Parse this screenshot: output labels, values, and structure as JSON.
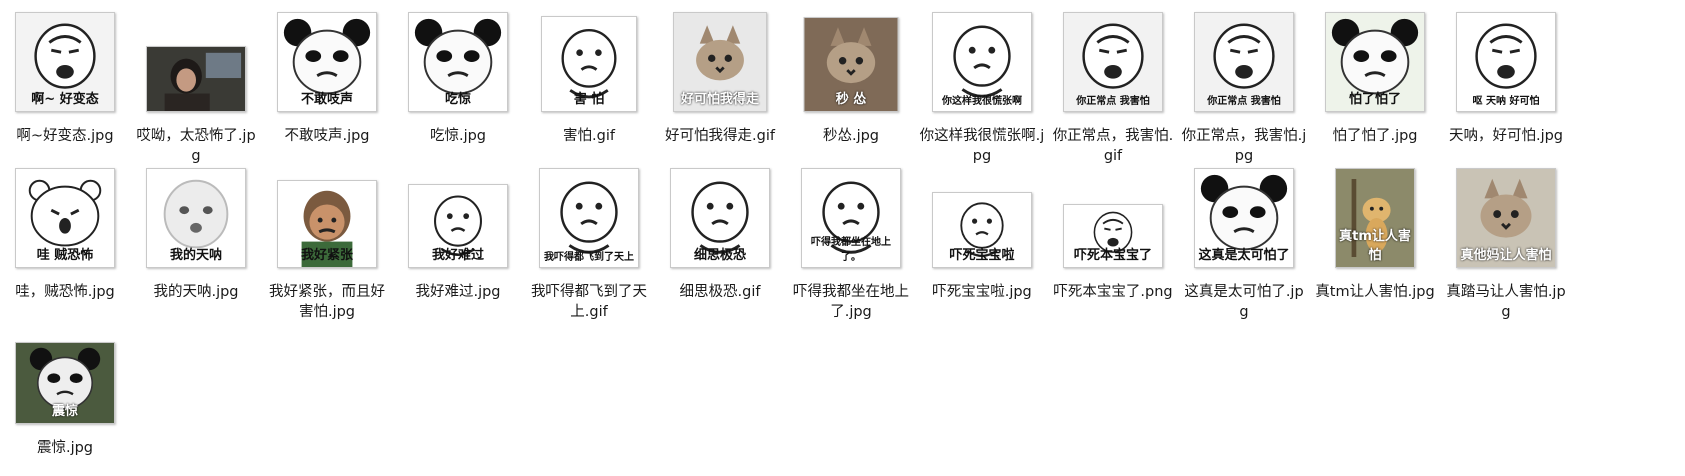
{
  "files": [
    {
      "name": "啊~好变态.jpg",
      "thumb_text": "啊~ 好变态",
      "kind": "man",
      "bg": "#f3f3f3"
    },
    {
      "name": "哎呦，太恐怖了.jpg",
      "thumb_text": "",
      "kind": "photo",
      "bg": "#3a3a35"
    },
    {
      "name": "不敢吱声.jpg",
      "thumb_text": "不敢吱声",
      "kind": "panda",
      "bg": "#ffffff"
    },
    {
      "name": "吃惊.jpg",
      "thumb_text": "吃惊",
      "kind": "panda",
      "bg": "#ffffff"
    },
    {
      "name": "害怕.gif",
      "thumb_text": "害 怕",
      "kind": "blob",
      "bg": "#ffffff"
    },
    {
      "name": "好可怕我得走.gif",
      "thumb_text": "好可怕我得走",
      "kind": "cat",
      "bg": "#e8e8e8"
    },
    {
      "name": "秒怂.jpg",
      "thumb_text": "秒 怂",
      "kind": "cat",
      "bg": "#7f6a57"
    },
    {
      "name": "你这样我很慌张啊.jpg",
      "thumb_text": "你这样我很慌张啊",
      "kind": "blob",
      "bg": "#ffffff"
    },
    {
      "name": "你正常点，我害怕.gif",
      "thumb_text": "你正常点 我害怕",
      "kind": "man",
      "bg": "#f2f2f2"
    },
    {
      "name": "你正常点，我害怕.jpg",
      "thumb_text": "你正常点 我害怕",
      "kind": "man",
      "bg": "#f2f2f2"
    },
    {
      "name": "怕了怕了.jpg",
      "thumb_text": "怕了怕了",
      "kind": "panda",
      "bg": "#eef3ea"
    },
    {
      "name": "天呐，好可怕.jpg",
      "thumb_text": "呕 天呐 好可怕",
      "kind": "man",
      "bg": "#ffffff"
    },
    {
      "name": "哇，贼恐怖.jpg",
      "thumb_text": "哇 贼恐怖",
      "kind": "bear",
      "bg": "#ffffff"
    },
    {
      "name": "我的天呐.jpg",
      "thumb_text": "我的天呐",
      "kind": "baby",
      "bg": "#ffffff"
    },
    {
      "name": "我好紧张，而且好害怕.jpg",
      "thumb_text": "我好紧张",
      "kind": "kid",
      "bg": "#ffffff"
    },
    {
      "name": "我好难过.jpg",
      "thumb_text": "我好难过",
      "kind": "blob",
      "bg": "#ffffff"
    },
    {
      "name": "我吓得都飞到了天上.gif",
      "thumb_text": "我吓得都飞到了天上",
      "kind": "blob",
      "bg": "#ffffff"
    },
    {
      "name": "细思极恐.gif",
      "thumb_text": "细思极恐",
      "kind": "blob",
      "bg": "#ffffff"
    },
    {
      "name": "吓得我都坐在地上了.jpg",
      "thumb_text": "吓得我都坐在地上了。",
      "kind": "blob",
      "bg": "#ffffff"
    },
    {
      "name": "吓死宝宝啦.jpg",
      "thumb_text": "吓死宝宝啦",
      "kind": "blob",
      "bg": "#ffffff"
    },
    {
      "name": "吓死本宝宝了.png",
      "thumb_text": "吓死本宝宝了",
      "kind": "man",
      "bg": "#ffffff"
    },
    {
      "name": "这真是太可怕了.jpg",
      "thumb_text": "这真是太可怕了",
      "kind": "panda",
      "bg": "#ffffff"
    },
    {
      "name": "真tm让人害怕.jpg",
      "thumb_text": "真tm让人害怕",
      "kind": "dog",
      "bg": "#8c8a6a"
    },
    {
      "name": "真踏马让人害怕.jpg",
      "thumb_text": "真他妈让人害怕",
      "kind": "cat",
      "bg": "#c9c3b5"
    },
    {
      "name": "震惊.jpg",
      "thumb_text": "震惊",
      "kind": "panda-photo",
      "bg": "#4b5a3e"
    }
  ]
}
